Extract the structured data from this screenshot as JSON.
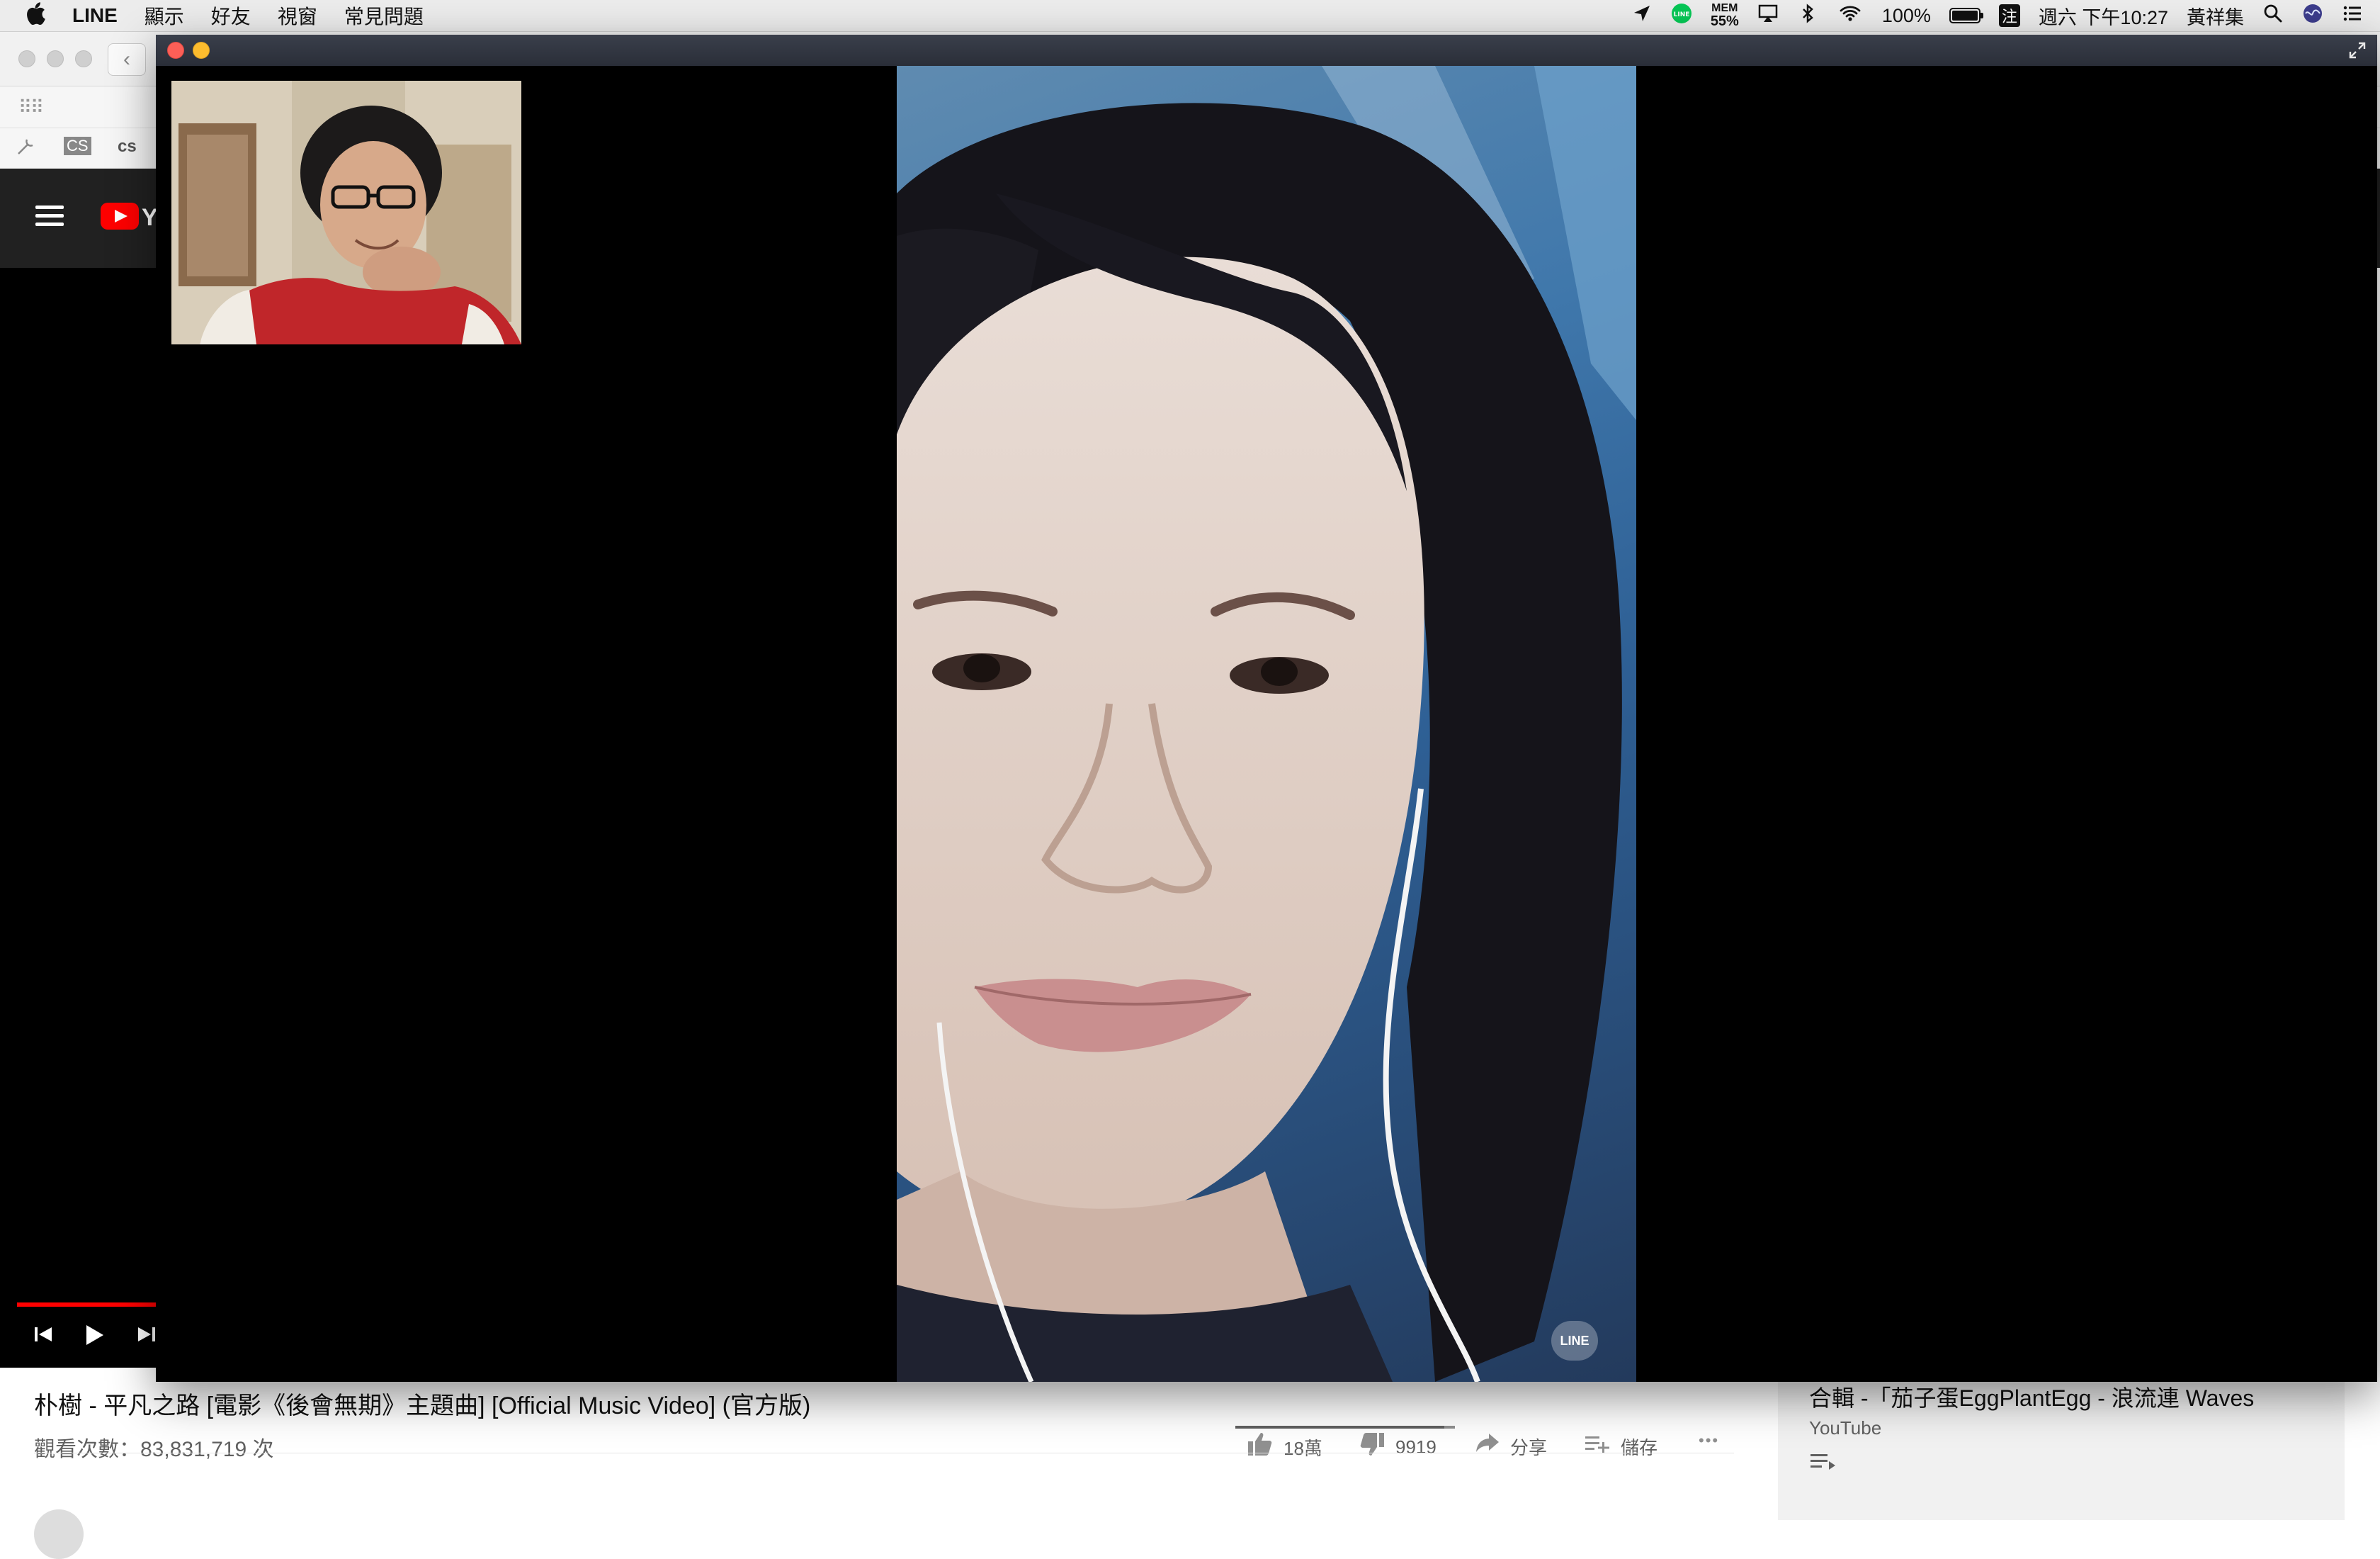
{
  "menubar": {
    "apple_icon": "apple-icon",
    "app_name": "LINE",
    "menus": [
      "顯示",
      "好友",
      "視窗",
      "常見問題"
    ],
    "status": {
      "mem_label": "MEM",
      "mem_value": "55%",
      "battery": "100%",
      "input_method": "注",
      "datetime": "週六 下午10:27",
      "user": "黃祥集"
    }
  },
  "browser": {
    "bookmarks": [
      "CS",
      "cs"
    ],
    "youtube": {
      "logo_text": "Yo",
      "video_title": "朴樹 - 平凡之路 [電影《後會無期》主題曲] [Official Music Video] (官方版)",
      "views": "觀看次數：83,831,719 次",
      "likes": "18萬",
      "dislikes": "9919",
      "like_ratio": 0.95,
      "share": "分享",
      "save": "儲存",
      "more": "•••",
      "sidebar_title": "合輯 -「茄子蛋EggPlantEgg - 浪流連 Waves",
      "sidebar_channel": "YouTube"
    }
  },
  "call": {
    "watermark": "LINE",
    "colors": {
      "close": "#fc5f57",
      "minimize": "#fdbc2e",
      "titlebar": "#2a2e38",
      "youtube_red": "#ff0000",
      "line_green": "#06c755"
    }
  }
}
